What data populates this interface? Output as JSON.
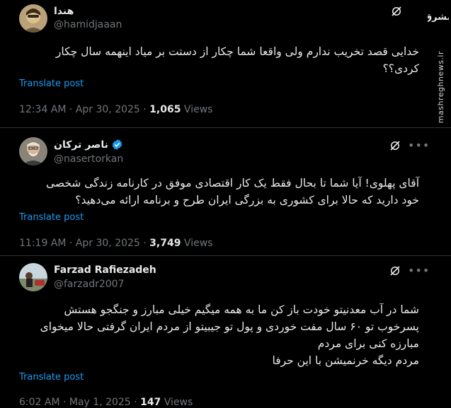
{
  "tweets": [
    {
      "name": "هندا",
      "handle": "@hamidjaaan",
      "verified": false,
      "text": "خدایی قصد تخریب ندارم ولی واقعا شما چکار از دستت بر میاد اینهمه سال چکار\nکردی؟؟",
      "translate": "Translate post",
      "time": "12:34 AM · Apr 30, 2025 · ",
      "views_count": "1,065",
      "views_label": " Views"
    },
    {
      "name": "ناصر ترکان",
      "handle": "@nasertorkan",
      "verified": true,
      "text": "آقای پهلوی! آیا شما تا بحال فقط یک کار اقتصادی موفق در کارنامه زندگی شخصی\nخود دارید که حالا برای کشوری به بزرگی ایران طرح و برنامه ارائه می‌دهید؟",
      "translate": "Translate post",
      "time": "11:19 AM · Apr 30, 2025 · ",
      "views_count": "3,749",
      "views_label": " Views"
    },
    {
      "name": "Farzad Rafiezadeh",
      "handle": "@farzadr2007",
      "verified": false,
      "text": "شما در آب معدنیتو خودت باز کن ما به همه میگیم خیلی مبارز و جنگجو هستش\nپسرخوب تو ۶۰ سال مفت خوردی و پول تو جیبیتو از مردم ایران گرفتی حالا میخوای\nمبارزه کنی برای مردم\nمردم دیگه خرنمیشن با این حرفا",
      "translate": "Translate post",
      "time": "6:02 AM · May 1, 2025 · ",
      "views_count": "147",
      "views_label": " Views"
    }
  ],
  "watermark": {
    "url": "mashreghnews.ir",
    "logo_text": "مشرق"
  },
  "colors": {
    "background": "#000000",
    "text": "#e7e9ea",
    "muted": "#71767b",
    "link": "#1d9bf0",
    "verified": "#1d9bf0",
    "separator": "#2f3336"
  },
  "icons": [
    "grok-icon",
    "more-icon",
    "verified-badge-icon"
  ]
}
